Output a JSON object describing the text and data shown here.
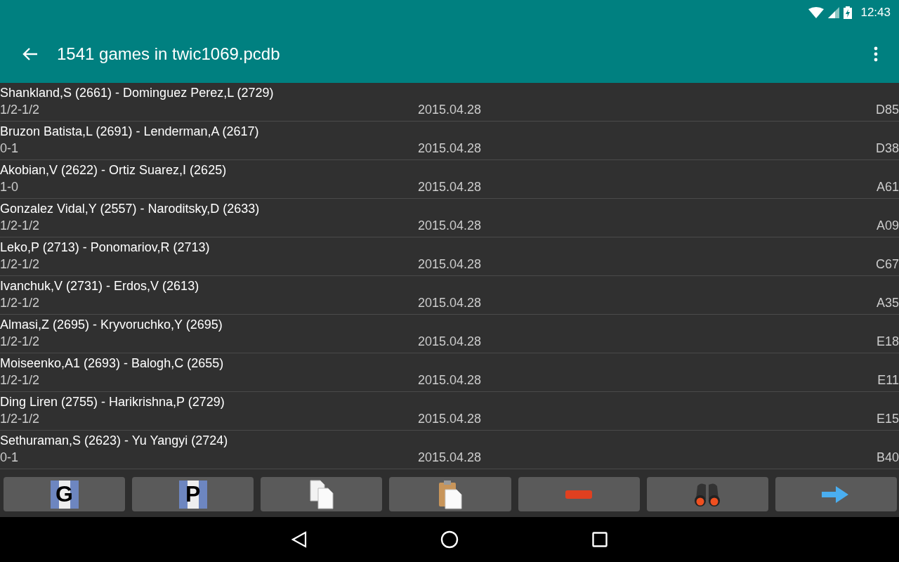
{
  "status_bar": {
    "time": "12:43"
  },
  "app_bar": {
    "title": "1541 games in twic1069.pcdb"
  },
  "games": [
    {
      "players": "Shankland,S (2661) - Dominguez Perez,L (2729)",
      "result": "1/2-1/2",
      "date": "2015.04.28",
      "eco": "D85"
    },
    {
      "players": "Bruzon Batista,L (2691) - Lenderman,A (2617)",
      "result": "0-1",
      "date": "2015.04.28",
      "eco": "D38"
    },
    {
      "players": "Akobian,V (2622) - Ortiz Suarez,I (2625)",
      "result": "1-0",
      "date": "2015.04.28",
      "eco": "A61"
    },
    {
      "players": "Gonzalez Vidal,Y (2557) - Naroditsky,D (2633)",
      "result": "1/2-1/2",
      "date": "2015.04.28",
      "eco": "A09"
    },
    {
      "players": "Leko,P (2713) - Ponomariov,R (2713)",
      "result": "1/2-1/2",
      "date": "2015.04.28",
      "eco": "C67"
    },
    {
      "players": "Ivanchuk,V (2731) - Erdos,V (2613)",
      "result": "1/2-1/2",
      "date": "2015.04.28",
      "eco": "A35"
    },
    {
      "players": "Almasi,Z (2695) - Kryvoruchko,Y (2695)",
      "result": "1/2-1/2",
      "date": "2015.04.28",
      "eco": "E18"
    },
    {
      "players": "Moiseenko,A1 (2693) - Balogh,C (2655)",
      "result": "1/2-1/2",
      "date": "2015.04.28",
      "eco": "E11"
    },
    {
      "players": "Ding Liren (2755) - Harikrishna,P (2729)",
      "result": "1/2-1/2",
      "date": "2015.04.28",
      "eco": "E15"
    },
    {
      "players": "Sethuraman,S (2623) - Yu Yangyi (2724)",
      "result": "0-1",
      "date": "2015.04.28",
      "eco": "B40"
    }
  ],
  "toolbar": [
    {
      "kind": "letter",
      "letter": "G"
    },
    {
      "kind": "letter",
      "letter": "P"
    },
    {
      "kind": "copy"
    },
    {
      "kind": "paste"
    },
    {
      "kind": "remove"
    },
    {
      "kind": "search"
    },
    {
      "kind": "forward"
    }
  ]
}
